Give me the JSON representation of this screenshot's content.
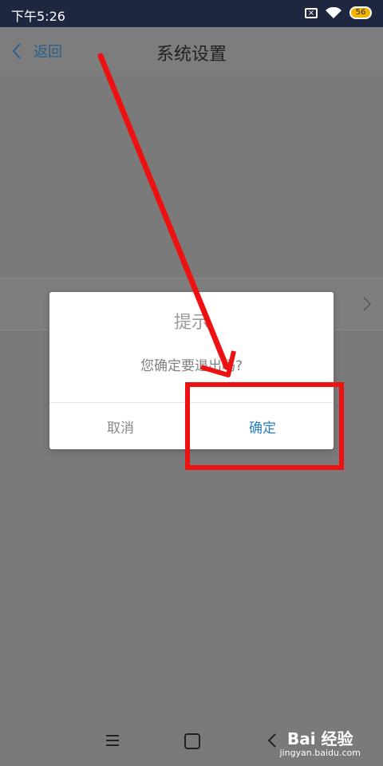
{
  "status_bar": {
    "time": "下午5:26",
    "battery": "56"
  },
  "header": {
    "back_label": "返回",
    "title": "系统设置"
  },
  "dialog": {
    "title": "提示",
    "message": "您确定要退出吗?",
    "cancel_label": "取消",
    "confirm_label": "确定"
  },
  "watermark": {
    "logo_text": "Bai 经验",
    "url": "jingyan.baidu.com"
  },
  "colors": {
    "accent": "#2b7fc1",
    "annotation": "#ee1111",
    "status_bar": "#1f2740"
  }
}
